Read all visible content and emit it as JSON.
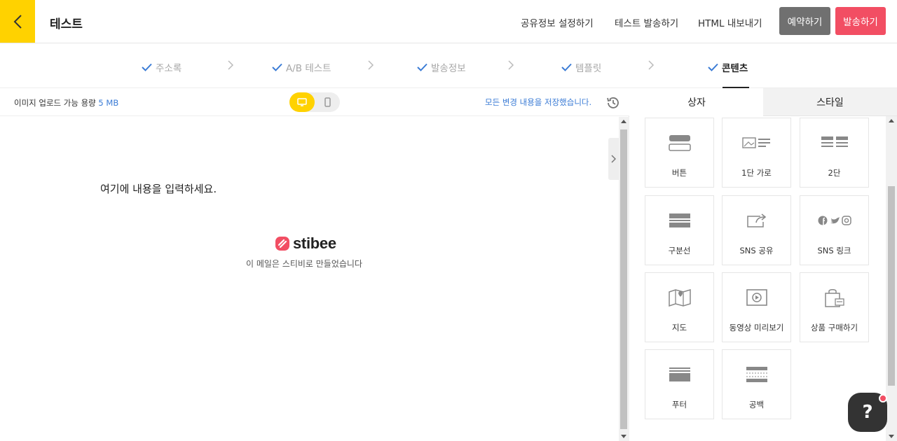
{
  "header": {
    "title": "테스트",
    "links": [
      "공유정보 설정하기",
      "테스트 발송하기",
      "HTML 내보내기"
    ],
    "reserve_label": "예약하기",
    "send_label": "발송하기"
  },
  "steps": [
    {
      "label": "주소록",
      "active": false
    },
    {
      "label": "A/B 테스트",
      "active": false
    },
    {
      "label": "발송정보",
      "active": false
    },
    {
      "label": "템플릿",
      "active": false
    },
    {
      "label": "콘텐츠",
      "active": true
    }
  ],
  "editor": {
    "upload_label": "이미지 업로드 가능 용량",
    "upload_size": "5 MB",
    "save_status": "모든 변경 내용을 저장했습니다.",
    "placeholder_text": "여기에 내용을 입력하세요.",
    "brand": "stibee",
    "made_by": "이 메일은 스티비로 만들었습니다"
  },
  "panel": {
    "tabs": [
      "상자",
      "스타일"
    ],
    "active_tab": "상자",
    "tiles": [
      {
        "label": "버튼",
        "icon": "button-block-icon"
      },
      {
        "label": "1단 가로",
        "icon": "one-column-horizontal-icon"
      },
      {
        "label": "2단",
        "icon": "two-column-icon"
      },
      {
        "label": "구분선",
        "icon": "divider-icon"
      },
      {
        "label": "SNS 공유",
        "icon": "share-icon"
      },
      {
        "label": "SNS 링크",
        "icon": "sns-links-icon"
      },
      {
        "label": "지도",
        "icon": "map-icon"
      },
      {
        "label": "동영상 미리보기",
        "icon": "video-icon"
      },
      {
        "label": "상품 구매하기",
        "icon": "shopping-bag-icon"
      },
      {
        "label": "푸터",
        "icon": "footer-icon"
      },
      {
        "label": "공백",
        "icon": "spacer-icon"
      }
    ]
  },
  "help": {
    "label": "?"
  },
  "colors": {
    "accent_yellow": "#ffd200",
    "send_red": "#f24e63",
    "reserve_gray": "#707070",
    "link_blue": "#3a7bd5",
    "check_blue": "#3a7bd5"
  }
}
